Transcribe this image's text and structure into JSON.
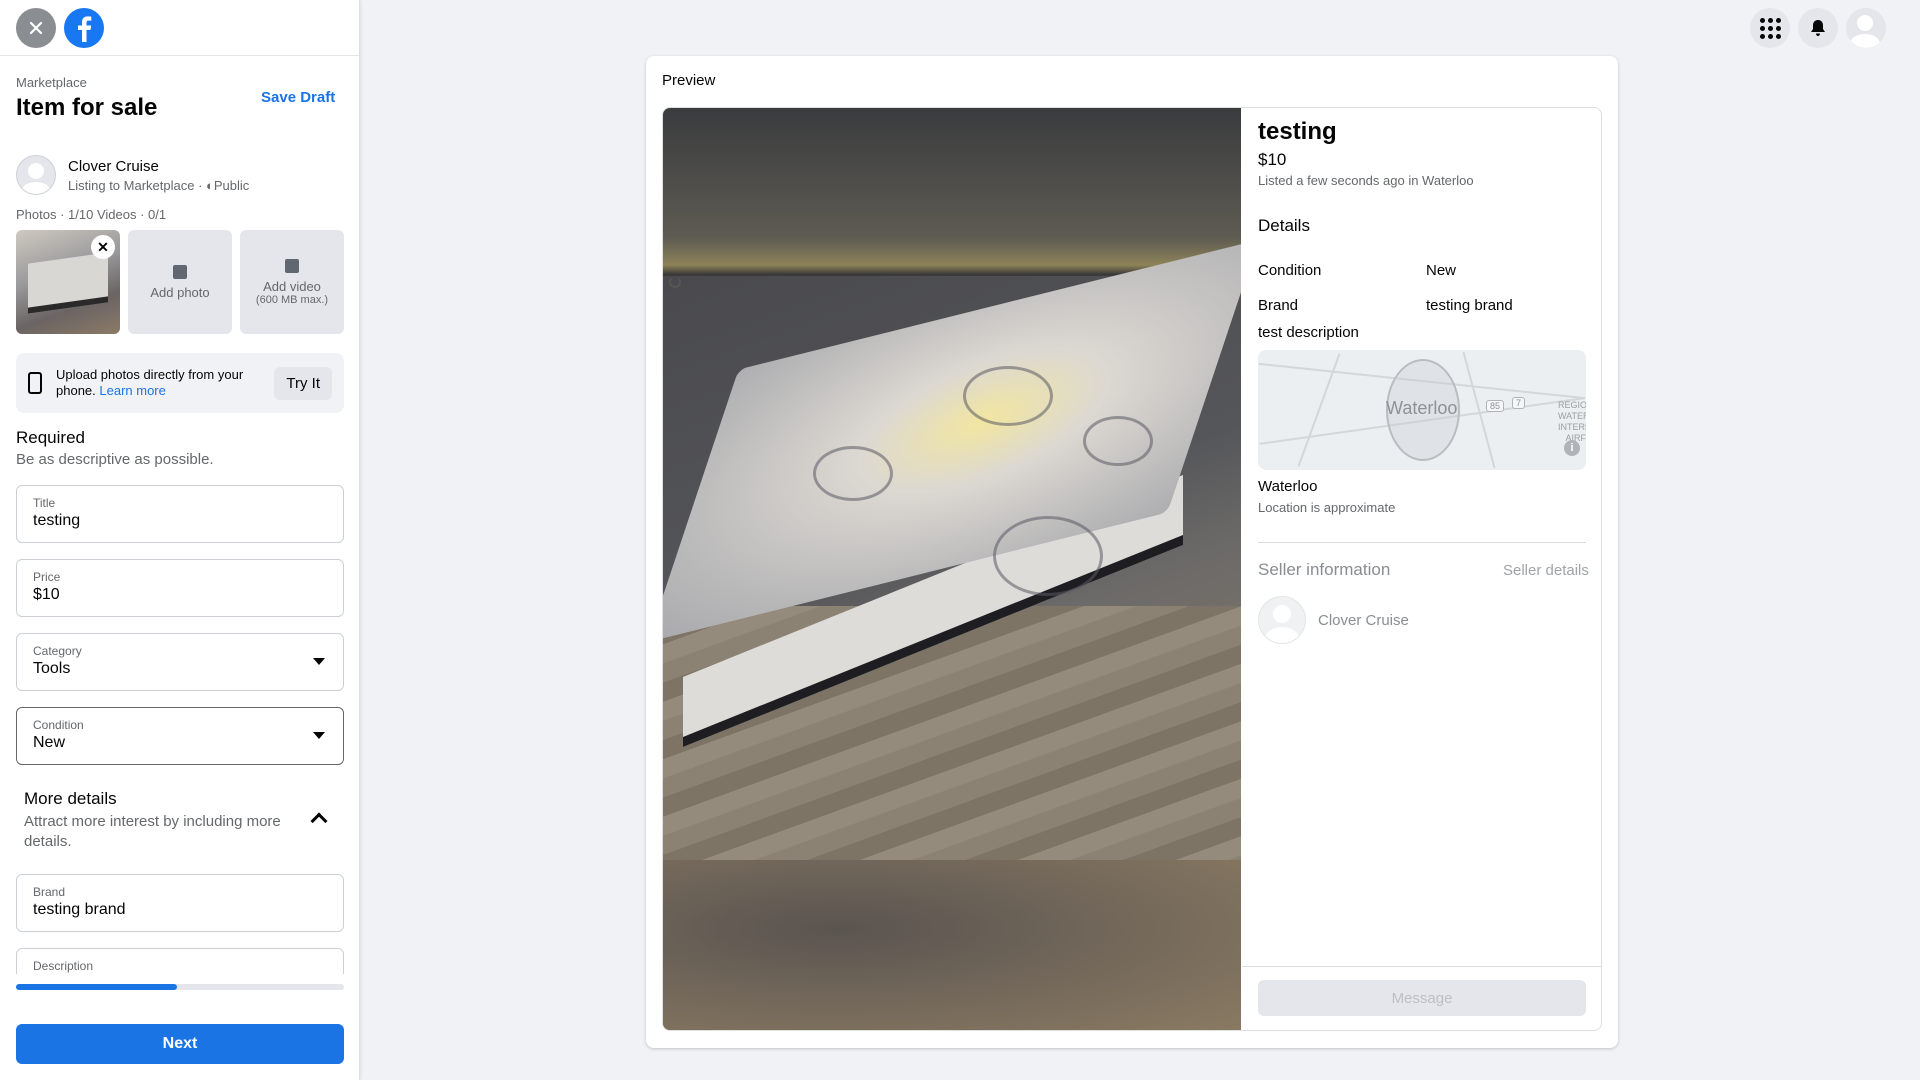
{
  "header": {
    "icons": [
      "close-icon",
      "facebook-logo-icon",
      "menu-grid-icon",
      "notifications-icon",
      "account-icon"
    ]
  },
  "sidebar": {
    "breadcrumb": "Marketplace",
    "page_title": "Item for sale",
    "save_draft": "Save Draft",
    "seller_name": "Clover Cruise",
    "listing_to": "Listing to Marketplace · ",
    "audience": "Public",
    "photos_count": "Photos · 1/10 Videos · 0/1",
    "add_photo": "Add photo",
    "add_video": "Add video",
    "add_video_sub": "(600 MB max.)",
    "upload_text": "Upload photos directly from your phone.",
    "learn_more": "Learn more",
    "try_it": "Try It",
    "required_title": "Required",
    "required_sub": "Be as descriptive as possible.",
    "fields": {
      "title": {
        "label": "Title",
        "value": "testing"
      },
      "price": {
        "label": "Price",
        "value": "$10"
      },
      "category": {
        "label": "Category",
        "value": "Tools"
      },
      "condition": {
        "label": "Condition",
        "value": "New"
      },
      "brand": {
        "label": "Brand",
        "value": "testing brand"
      },
      "description": {
        "label": "Description"
      }
    },
    "more_details_title": "More details",
    "more_details_sub": "Attract more interest by including more details.",
    "progress": 0.49,
    "next": "Next"
  },
  "preview": {
    "label": "Preview",
    "title": "testing",
    "price": "$10",
    "listed": "Listed a few seconds ago in Waterloo",
    "details_title": "Details",
    "details": [
      {
        "key": "Condition",
        "value": "New"
      },
      {
        "key": "Brand",
        "value": "testing brand"
      }
    ],
    "description": "test description",
    "map_label": "Waterloo",
    "map_badge_1": "85",
    "map_badge_2": "7",
    "map_region": "REGIO WATER INTERNATIC AIRF",
    "city": "Waterloo",
    "approx": "Location is approximate",
    "seller_info": "Seller information",
    "seller_details": "Seller details",
    "seller_name": "Clover Cruise",
    "message": "Message"
  },
  "colors": {
    "accent": "#1b74e4",
    "facebook_blue": "#1877f2",
    "background": "#f0f2f5"
  }
}
